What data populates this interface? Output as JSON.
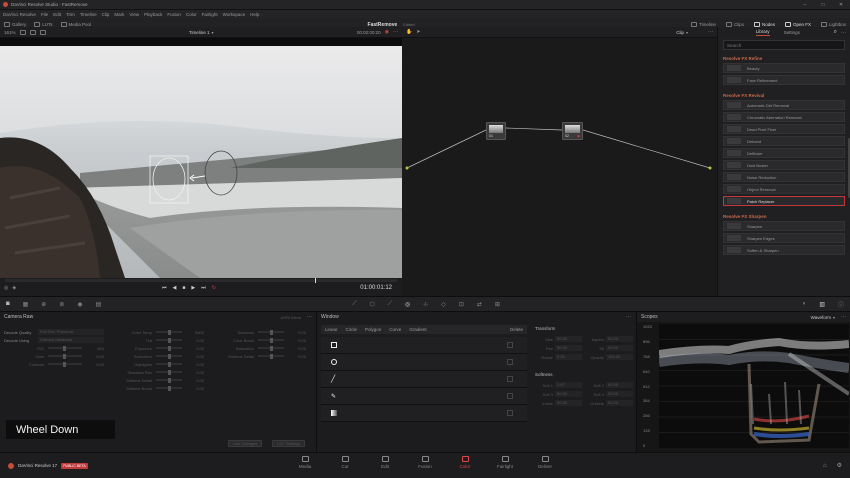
{
  "titlebar": {
    "title": "DaVinci Resolve Studio - FastRemove"
  },
  "menu": [
    "DaVinci Resolve",
    "File",
    "Edit",
    "Trim",
    "Timeline",
    "Clip",
    "Mark",
    "View",
    "Playback",
    "Fusion",
    "Color",
    "Fairlight",
    "Workspace",
    "Help"
  ],
  "toolbar": {
    "gallery": "Gallery",
    "luts": "LUTs",
    "media_pool": "Media Pool",
    "project": "FastRemove",
    "edited": "Edited",
    "timeline": "Timeline",
    "clips": "Clips",
    "nodes": "Nodes",
    "open_fx": "Open FX",
    "lightbox": "Lightbox"
  },
  "viewer": {
    "zoom": "161%",
    "timeline_name": "Timeline 1",
    "timecode_top": "00:02:00:20",
    "timecode": "01:00:01:12",
    "overlay": "Wheel Down",
    "playhead_pct": 79
  },
  "nodes": {
    "mode": "Clip",
    "node1": "01",
    "node2": "02"
  },
  "library": {
    "tabs": [
      "Library",
      "Settings"
    ],
    "search_placeholder": "Search",
    "sections": [
      {
        "title": "Resolve FX Refine",
        "items": [
          "Beauty",
          "Face Refinement"
        ]
      },
      {
        "title": "Resolve FX Revival",
        "items": [
          "Automatic Dirt Removal",
          "Chromatic Aberration Removal",
          "Dead Pixel Fixer",
          "Deband",
          "Deflicker",
          "Dust Buster",
          "Noise Reduction",
          "Object Removal",
          "Patch Replacer"
        ]
      },
      {
        "title": "Resolve FX Sharpen",
        "items": [
          "Sharpen",
          "Sharpen Edges",
          "Soften & Sharpen"
        ]
      }
    ],
    "selected": "Patch Replacer"
  },
  "camraw": {
    "title": "Camera Raw",
    "mode": "ARRI Alexa",
    "decode_quality_label": "Decode Quality",
    "decode_quality_value": "Full Res. Premium",
    "decode_using_label": "Decode Using",
    "decode_using_value": "Camera Metadata",
    "left": [
      {
        "l": "ISO",
        "v": "800"
      },
      {
        "l": "Gain",
        "v": "0.00"
      },
      {
        "l": "Contrast",
        "v": "0.00"
      }
    ],
    "mid": [
      {
        "l": "Color Temp",
        "v": "5600"
      },
      {
        "l": "Tint",
        "v": "0.00"
      },
      {
        "l": "Exposure",
        "v": "0.00"
      },
      {
        "l": "Saturation",
        "v": "0.00"
      },
      {
        "l": "Highlights",
        "v": "0.00"
      },
      {
        "l": "Shadows Rec",
        "v": "0.00"
      },
      {
        "l": "Midtone Detail",
        "v": "0.00"
      },
      {
        "l": "Midtone Boost",
        "v": "0.00"
      }
    ],
    "right": [
      {
        "l": "Shadows",
        "v": "0.00"
      },
      {
        "l": "Color Boost",
        "v": "0.00"
      },
      {
        "l": "Saturation",
        "v": "0.00"
      },
      {
        "l": "Midtone Detail",
        "v": "0.00"
      }
    ],
    "use_changes": "Use Changes",
    "lut_settings": "LUT Settings"
  },
  "window": {
    "title": "Window",
    "tools": [
      "Linear",
      "Circle",
      "Polygon",
      "Curve",
      "Gradient"
    ],
    "delete": "Delete",
    "transform_title": "Transform",
    "transform": [
      {
        "l": "Size",
        "v": "50.00"
      },
      {
        "l": "Aspect",
        "v": "50.00"
      },
      {
        "l": "Pan",
        "v": "50.00"
      },
      {
        "l": "Tilt",
        "v": "50.00"
      },
      {
        "l": "Rotate",
        "v": "0.00"
      },
      {
        "l": "Opacity",
        "v": "100.00"
      }
    ],
    "softness_title": "Softness",
    "softness": [
      {
        "l": "Soft 1",
        "v": "2.67"
      },
      {
        "l": "Soft 2",
        "v": "50.00"
      },
      {
        "l": "Soft 3",
        "v": "50.00"
      },
      {
        "l": "Soft 4",
        "v": "50.00"
      },
      {
        "l": "Inside",
        "v": "50.00"
      },
      {
        "l": "Outside",
        "v": "50.00"
      }
    ]
  },
  "scopes": {
    "title": "Scopes",
    "mode": "Waveform",
    "ticks": [
      "1023",
      "896",
      "768",
      "640",
      "512",
      "384",
      "256",
      "128",
      "0"
    ]
  },
  "pagebar": {
    "app": "DaVinci Resolve 17",
    "badge": "PUBLIC BETA",
    "pages": [
      "Media",
      "Cut",
      "Edit",
      "Fusion",
      "Color",
      "Fairlight",
      "Deliver"
    ],
    "active": "Color"
  }
}
